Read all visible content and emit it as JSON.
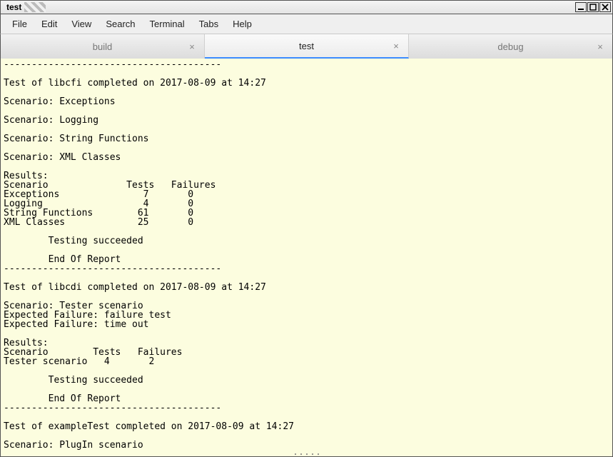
{
  "window": {
    "title": "test"
  },
  "menubar": {
    "items": [
      "File",
      "Edit",
      "View",
      "Search",
      "Terminal",
      "Tabs",
      "Help"
    ]
  },
  "tabs": {
    "items": [
      {
        "label": "build",
        "active": false
      },
      {
        "label": "test",
        "active": true
      },
      {
        "label": "debug",
        "active": false
      }
    ]
  },
  "terminal": {
    "text": "---------------------------------------\n\nTest of libcfi completed on 2017-08-09 at 14:27\n\nScenario: Exceptions\n\nScenario: Logging\n\nScenario: String Functions\n\nScenario: XML Classes\n\nResults:\nScenario              Tests   Failures\nExceptions               7       0\nLogging                  4       0\nString Functions        61       0\nXML Classes             25       0\n\n        Testing succeeded\n\n        End Of Report\n---------------------------------------\n\nTest of libcdi completed on 2017-08-09 at 14:27\n\nScenario: Tester scenario\nExpected Failure: failure test\nExpected Failure: time out\n\nResults:\nScenario        Tests   Failures\nTester scenario   4       2\n\n        Testing succeeded\n\n        End Of Report\n---------------------------------------\n\nTest of exampleTest completed on 2017-08-09 at 14:27\n\nScenario: PlugIn scenario"
  }
}
